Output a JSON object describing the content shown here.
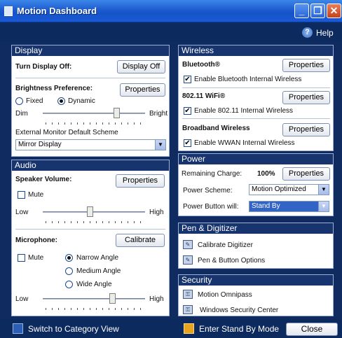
{
  "window": {
    "title": "Motion Dashboard",
    "help_label": "Help"
  },
  "display": {
    "header": "Display",
    "turn_off_label": "Turn Display Off:",
    "turn_off_button": "Display Off",
    "brightness_label": "Brightness Preference:",
    "properties_button": "Properties",
    "fixed_label": "Fixed",
    "dynamic_label": "Dynamic",
    "selected_mode": "Dynamic",
    "dim_label": "Dim",
    "bright_label": "Bright",
    "brightness_level": 0.72,
    "monitor_label": "External Monitor Default Scheme",
    "monitor_value": "Mirror Display"
  },
  "audio": {
    "header": "Audio",
    "speaker_label": "Speaker Volume:",
    "properties_button": "Properties",
    "mute_label": "Mute",
    "low_label": "Low",
    "high_label": "High",
    "speaker_level": 0.46,
    "mic_label": "Microphone:",
    "calibrate_button": "Calibrate",
    "mic_mute_label": "Mute",
    "narrow_label": "Narrow Angle",
    "medium_label": "Medium Angle",
    "wide_label": "Wide Angle",
    "selected_angle": "Narrow Angle",
    "mic_low_label": "Low",
    "mic_high_label": "High",
    "mic_level": 0.68
  },
  "wireless": {
    "header": "Wireless",
    "bluetooth_label": "Bluetooth®",
    "bluetooth_button": "Properties",
    "bluetooth_enable": "Enable Bluetooth Internal  Wireless",
    "wifi_label": "802.11 WiFi®",
    "wifi_button": "Properties",
    "wifi_enable": "Enable 802.11 Internal Wireless",
    "wwan_label": "Broadband Wireless",
    "wwan_button": "Properties",
    "wwan_enable": "Enable WWAN Internal Wireless"
  },
  "power": {
    "header": "Power",
    "charge_label": "Remaining Charge:",
    "charge_value": "100%",
    "properties_button": "Properties",
    "scheme_label": "Power Scheme:",
    "scheme_value": "Motion Optimized",
    "button_label": "Power Button will:",
    "button_value": "Stand By"
  },
  "pen": {
    "header": "Pen & Digitizer",
    "calibrate": "Calibrate Digitizer",
    "options": "Pen & Button Options"
  },
  "security": {
    "header": "Security",
    "omnipass": "Motion Omnipass",
    "center": "Windows Security Center"
  },
  "footer": {
    "category_view": "Switch to Category View",
    "standby": "Enter Stand By Mode",
    "close": "Close"
  },
  "colors": {
    "header_bg": "#17346f",
    "window_bg": "#0f2b5f",
    "titlebar": "#1e5dd0"
  }
}
